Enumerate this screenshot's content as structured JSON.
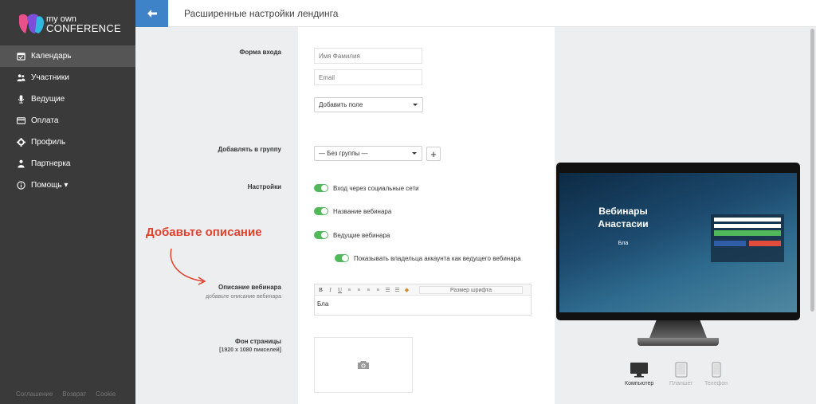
{
  "sidebar": {
    "logo_line1": "my own",
    "logo_line2": "CONFERENCE",
    "items": [
      {
        "label": "Календарь",
        "icon": "calendar-icon"
      },
      {
        "label": "Участники",
        "icon": "users-icon"
      },
      {
        "label": "Ведущие",
        "icon": "microphone-icon"
      },
      {
        "label": "Оплата",
        "icon": "credit-card-icon"
      },
      {
        "label": "Профиль",
        "icon": "gear-icon"
      },
      {
        "label": "Партнерка",
        "icon": "partner-icon"
      },
      {
        "label": "Помощь ▾",
        "icon": "info-icon"
      }
    ],
    "footer": [
      "Соглашение",
      "Возврат",
      "Cookie"
    ]
  },
  "header": {
    "title": "Расширенные настройки лендинга"
  },
  "form": {
    "login_form_label": "Форма входа",
    "name_placeholder": "Имя Фамилия",
    "email_placeholder": "Email",
    "add_field_select": "Добавить поле",
    "add_to_group_label": "Добавлять в группу",
    "group_select": "— Без группы —",
    "plus": "+",
    "settings_label": "Настройки",
    "toggles": [
      "Вход через социальные сети",
      "Название вебинара",
      "Ведущие вебинара",
      "Показывать владельца аккаунта как ведущего вебинара"
    ],
    "description_label": "Описание вебинара",
    "description_sublabel": "добавьте описание вебинара",
    "font_size_select": "Размер шрифта",
    "description_value": "Бла",
    "background_label": "Фон страницы",
    "background_sublabel": "[1920 x 1080 пикселей]"
  },
  "annotation": "Добавьте описание",
  "preview": {
    "title": "Вебинары Анастасии",
    "subtitle": "Бла",
    "devices": [
      {
        "label": "Компьютер",
        "icon": "desktop-icon",
        "active": true
      },
      {
        "label": "Планшет",
        "icon": "tablet-icon",
        "active": false
      },
      {
        "label": "Телефон",
        "icon": "phone-icon",
        "active": false
      }
    ]
  },
  "colors": {
    "sidebar_bg": "#3a3a3a",
    "accent_blue": "#3e82c8",
    "toggle_green": "#52b95a",
    "annotation_red": "#e0412c"
  }
}
